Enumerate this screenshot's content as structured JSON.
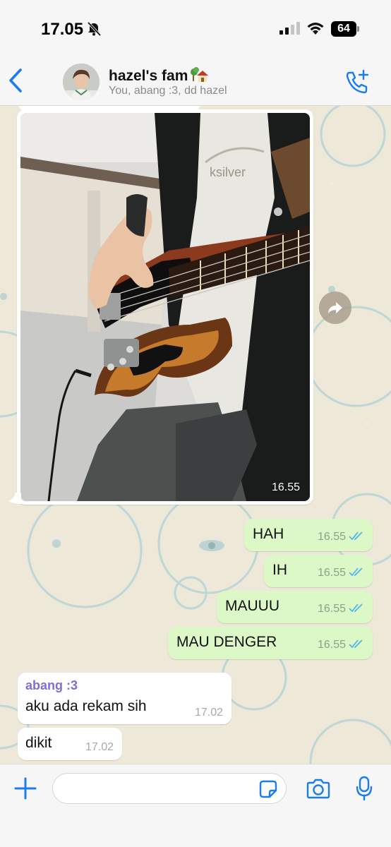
{
  "status_bar": {
    "time": "17.05",
    "battery": "64",
    "icons": [
      "bell-slash-icon",
      "signal-icon",
      "wifi-icon",
      "battery-icon"
    ]
  },
  "header": {
    "group_name": "hazel's fam",
    "group_emoji": "house-with-garden-icon",
    "members": "You, abang :3, dd hazel",
    "icons": [
      "back-chevron-icon",
      "add-call-icon"
    ]
  },
  "messages": [
    {
      "type": "image",
      "direction": "incoming",
      "time": "16.55"
    },
    {
      "type": "text",
      "direction": "outgoing",
      "text": "HAH",
      "time": "16.55",
      "status": "read"
    },
    {
      "type": "text",
      "direction": "outgoing",
      "text": "IH",
      "time": "16.55",
      "status": "read"
    },
    {
      "type": "text",
      "direction": "outgoing",
      "text": "MAUUU",
      "time": "16.55",
      "status": "read"
    },
    {
      "type": "text",
      "direction": "outgoing",
      "text": "MAU DENGER",
      "time": "16.55",
      "status": "read"
    },
    {
      "type": "text",
      "direction": "incoming",
      "sender": "abang :3",
      "text": "aku ada rekam sih",
      "time": "17.02"
    },
    {
      "type": "text",
      "direction": "incoming",
      "text": "dikit",
      "time": "17.02"
    }
  ],
  "composer": {
    "placeholder": "",
    "icons": [
      "plus-icon",
      "sticker-icon",
      "camera-icon",
      "microphone-icon"
    ]
  },
  "colors": {
    "accent": "#1b7cf0",
    "outgoing_bubble": "#dcf8c6",
    "incoming_bubble": "#ffffff",
    "read_ticks": "#4fb6ec",
    "sender_name": "#7c6fd6",
    "wallpaper": "#ede8d8"
  }
}
